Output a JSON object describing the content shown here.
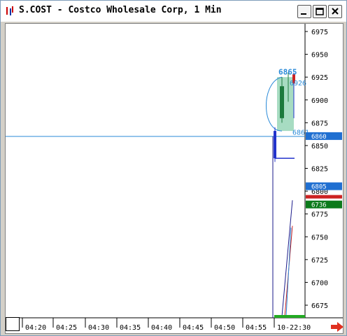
{
  "window": {
    "title": "S.COST - Costco Wholesale Corp, 1 Min",
    "icon_name": "chart-app-icon"
  },
  "controls": {
    "minimize_icon": "minimize-icon",
    "maximize_icon": "maximize-icon",
    "close_icon": "close-icon"
  },
  "chart_data": {
    "type": "candlestick",
    "y_ticks": [
      "6975",
      "6950",
      "6925",
      "6900",
      "6875",
      "6850",
      "6825",
      "6800",
      "6775",
      "6750",
      "6725",
      "6700",
      "6675"
    ],
    "x_ticks": [
      "04:20",
      "04:25",
      "04:30",
      "04:35",
      "04:40",
      "04:45",
      "04:50",
      "04:55",
      "10-22:30"
    ],
    "ylim": [
      6655,
      6990
    ],
    "horizontal_line": 6860,
    "price_tags": [
      {
        "text": "6860",
        "color": "#1f6fd1"
      },
      {
        "text": "6805",
        "color": "#1f6fd1"
      },
      {
        "text": "6736",
        "color": "#0b7a1a"
      }
    ],
    "annotations": {
      "top": "6865",
      "upper": "6926",
      "lower": "6861"
    },
    "colors": {
      "candle_up": "#1c7a3d",
      "candle_dn": "#2233cc",
      "bar_red": "#cc2222",
      "highlight": "#5fbf8f",
      "hline": "#2a8ad8",
      "volume": "#22aa22"
    }
  },
  "corner_arrow": "right-arrow-icon"
}
